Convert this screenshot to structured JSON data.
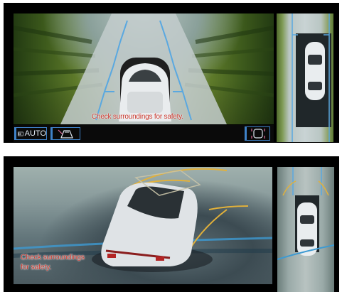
{
  "top_screen": {
    "front_view": {
      "warning": "Check surroundings for safety."
    },
    "bottom_bar": {
      "auto_label": "AUTO",
      "camera_icon": "car-camera-icon",
      "front_rear_icon": "car-front-rear-icon"
    },
    "side_view": {
      "icon": "top-down-car"
    }
  },
  "bottom_screen": {
    "main_view": {
      "warning_line1": "Check surroundings",
      "warning_line2": "for safety."
    },
    "side_view": {
      "icon": "top-down-car"
    }
  },
  "colors": {
    "accent": "#3f82c8",
    "warning": "#c8362c",
    "guide_line": "#e2b13a",
    "guide_blue": "#5aa8e0"
  }
}
